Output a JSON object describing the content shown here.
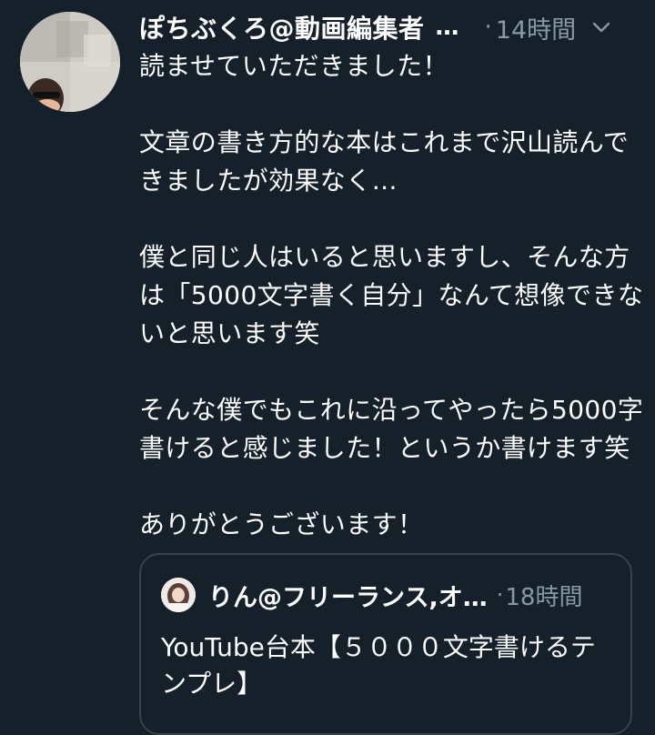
{
  "tweet": {
    "author": {
      "display_name": "ぽちぶくろ@動画編集者",
      "truncation": "…",
      "avatar_icon": "avatar-photo"
    },
    "separator": "·",
    "time": "14時間",
    "menu_icon": "chevron-down-icon",
    "text": "読ませていただきました！\n\n文章の書き方的な本はこれまで沢山読んできましたが効果なく…\n\n僕と同じ人はいると思いますし、そんな方は「5000文字書く自分」なんて想像できないと思います笑\n\nそんな僕でもこれに沿ってやったら5000字書けると感じました！というか書けます笑\n\nありがとうございます！"
  },
  "quoted_tweet": {
    "author": {
      "display_name": "りん@フリーランス,オ…",
      "avatar_icon": "avatar-photo"
    },
    "separator": "·",
    "time": "18時間",
    "text": "YouTube台本【５０００文字書けるテンプレ】"
  },
  "colors": {
    "background": "#15202b",
    "text_primary": "#ffffff",
    "text_secondary": "#8899a6",
    "border": "#38444d"
  }
}
